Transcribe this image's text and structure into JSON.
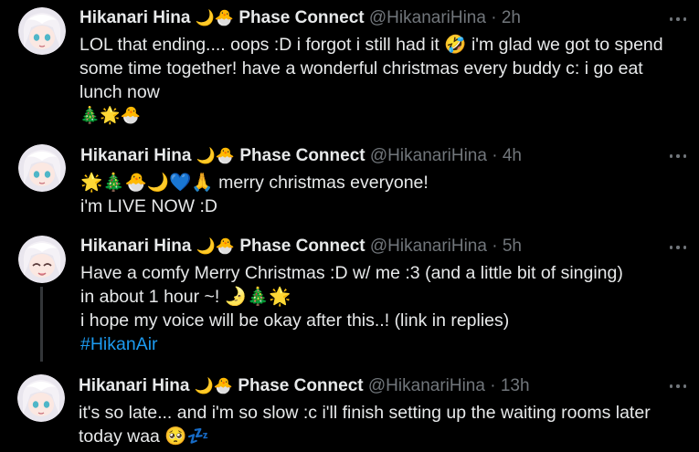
{
  "tweets": [
    {
      "name": "Hikanari Hina",
      "name_emojis": "🌙🐣",
      "affiliation": "Phase Connect",
      "handle": "@HikanariHina",
      "separator": "·",
      "time": "2h",
      "lines": [
        "LOL that ending.... oops :D i forgot i still had it 🤣 i'm glad we got to spend",
        "some time together! have a wonderful christmas every buddy c: i go eat",
        "lunch now",
        "🎄🌟🐣"
      ]
    },
    {
      "name": "Hikanari Hina",
      "name_emojis": "🌙🐣",
      "affiliation": "Phase Connect",
      "handle": "@HikanariHina",
      "separator": "·",
      "time": "4h",
      "lines": [
        "🌟🎄🐣🌙💙🙏 merry christmas everyone!",
        "i'm LIVE NOW :D"
      ]
    },
    {
      "name": "Hikanari Hina",
      "name_emojis": "🌙🐣",
      "affiliation": "Phase Connect",
      "handle": "@HikanariHina",
      "separator": "·",
      "time": "5h",
      "lines": [
        "Have a comfy Merry Christmas :D w/ me :3 (and a little bit of singing)",
        "in about 1 hour ~!  🌛🎄🌟",
        "i hope my voice will be okay after this..! (link in replies)"
      ],
      "hashtag": "#HikanAir"
    },
    {
      "name": "Hikanari Hina",
      "name_emojis": "🌙🐣",
      "affiliation": "Phase Connect",
      "handle": "@HikanariHina",
      "separator": "·",
      "time": "13h",
      "lines": [
        "it's so late... and i'm so slow :c i'll finish setting up the waiting rooms later",
        "today waa 🥺💤"
      ]
    }
  ],
  "colors": {
    "background": "#000000",
    "text": "#e7e9ea",
    "muted": "#71767b",
    "link": "#1d9bf0"
  },
  "icons": {
    "more": "more-dots-icon",
    "avatar": "avatar-anime-girl"
  }
}
